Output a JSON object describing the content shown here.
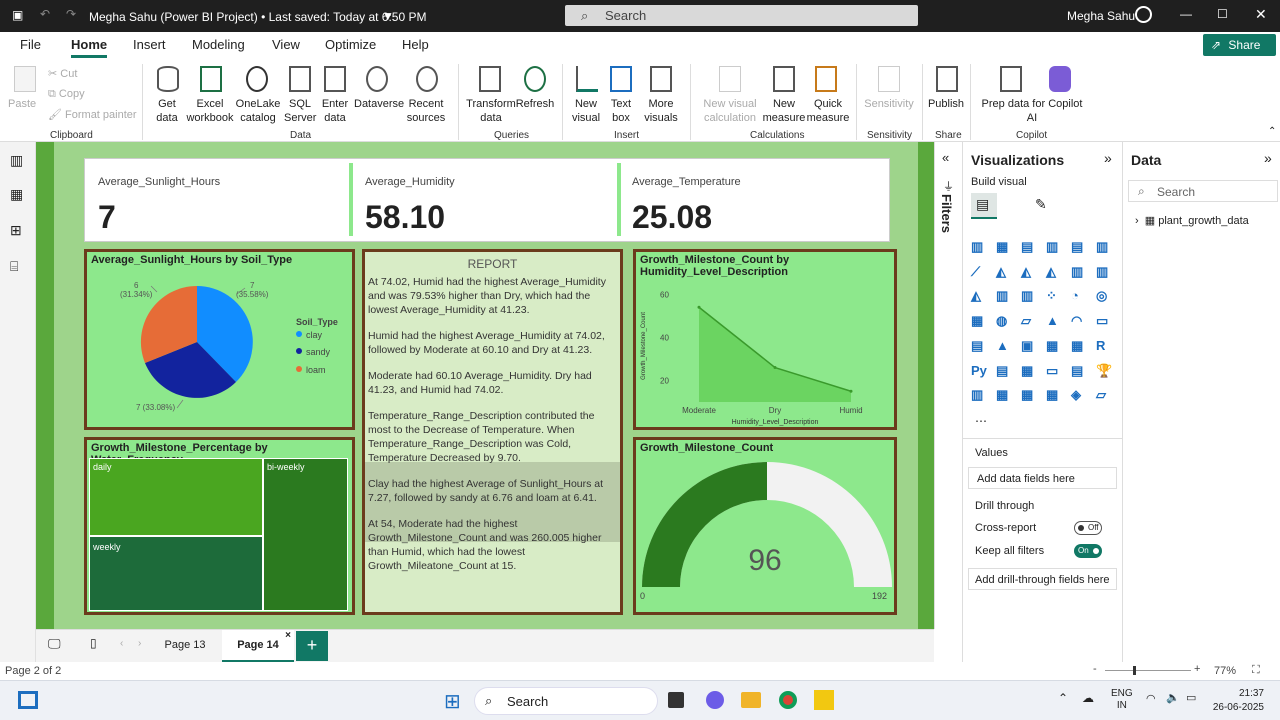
{
  "window": {
    "title": "Megha Sahu (Power BI Project) • Last saved: Today at 6:50 PM",
    "search_placeholder": "Search",
    "user": "Megha Sahu",
    "share": "Share"
  },
  "menu": [
    "File",
    "Home",
    "Insert",
    "Modeling",
    "View",
    "Optimize",
    "Help"
  ],
  "ribbon": {
    "clipboard": {
      "paste": "Paste",
      "cut": "Cut",
      "copy": "Copy",
      "format_painter": "Format painter",
      "group": "Clipboard"
    },
    "data": {
      "get_data": "Get data",
      "excel": "Excel workbook",
      "onelake": "OneLake catalog",
      "sql": "SQL Server",
      "enter": "Enter data",
      "dataverse": "Dataverse",
      "recent": "Recent sources",
      "group": "Data"
    },
    "queries": {
      "transform": "Transform data",
      "refresh": "Refresh",
      "group": "Queries"
    },
    "insert": {
      "new_visual": "New visual",
      "text_box": "Text box",
      "more_visuals": "More visuals",
      "group": "Insert"
    },
    "calculations": {
      "new_visual_calc": "New visual calculation",
      "new_measure": "New measure",
      "quick_measure": "Quick measure",
      "group": "Calculations"
    },
    "sensitivity": {
      "label": "Sensitivity",
      "group": "Sensitivity"
    },
    "share": {
      "publish": "Publish",
      "group": "Share"
    },
    "copilot": {
      "prep": "Prep data for Copilot AI",
      "group": "Copilot"
    }
  },
  "kpis": [
    {
      "label": "Average_Sunlight_Hours",
      "value": "7"
    },
    {
      "label": "Average_Humidity",
      "value": "58.10"
    },
    {
      "label": "Average_Temperature",
      "value": "25.08"
    }
  ],
  "pie": {
    "title": "Average_Sunlight_Hours by Soil_Type",
    "legend_title": "Soil_Type",
    "labels": {
      "clay_val": "7",
      "clay_pct": "(35.58%)",
      "sandy": "7 (33.08%)",
      "loam_val": "6",
      "loam_pct": "(31.34%)"
    },
    "legend": [
      "clay",
      "sandy",
      "loam"
    ],
    "colors": [
      "#118dff",
      "#12239e",
      "#e66c37"
    ]
  },
  "report": {
    "heading": "REPORT",
    "p1": "At 74.02, Humid had the highest Average_Humidity and was 79.53% higher than Dry, which had the lowest Average_Humidity at 41.23.",
    "p2": "Humid had the highest Average_Humidity at 74.02, followed by Moderate at 60.10 and Dry at 41.23.",
    "p3": "Moderate had 60.10 Average_Humidity. Dry had 41.23, and Humid had 74.02.",
    "p4": "Temperature_Range_Description contributed the most to the Decrease of Temperature. When Temperature_Range_Description was Cold, Temperature Decreased by 9.70.",
    "p5": "Clay had the highest Average of Sunlight_Hours at 7.27, followed by sandy at 6.76 and loam at 6.41.",
    "p6": "At 54, Moderate  had the highest Growth_Milestone_Count and was 260.005 higher than Humid, which had the lowest Growth_Mileatone_Count at 15."
  },
  "treemap": {
    "title": "Growth_Milestone_Percentage by Water_Frequency",
    "cells": [
      "daily",
      "bi-weekly",
      "weekly"
    ]
  },
  "gauge": {
    "title": "Growth_Milestone_Count",
    "value": "96",
    "min": "0",
    "max": "192"
  },
  "chart_data": {
    "type": "area",
    "title": "Growth_Milestone_Count by Humidity_Level_Description",
    "categories": [
      "Moderate",
      "Dry",
      "Humid"
    ],
    "values": [
      54,
      26,
      15
    ],
    "xlabel": "Humidity_Level_Description",
    "ylabel": "Growth_Milestone_Count",
    "yticks": [
      "60",
      "40",
      "20"
    ],
    "ylim": [
      10,
      62
    ]
  },
  "filters_label": "Filters",
  "visualizations": {
    "title": "Visualizations",
    "build": "Build visual",
    "values": "Values",
    "add_data": "Add data fields here",
    "drill": "Drill through",
    "cross": "Cross-report",
    "cross_state": "Off",
    "keep": "Keep all filters",
    "keep_state": "On",
    "add_drill": "Add drill-through fields here"
  },
  "data_pane": {
    "title": "Data",
    "search": "Search",
    "table": "plant_growth_data"
  },
  "tabs": [
    "Page 13",
    "Page 14"
  ],
  "status": {
    "page": "Page 2 of 2",
    "zoom": "77%"
  },
  "taskbar": {
    "search": "Search",
    "lang1": "ENG",
    "lang2": "IN",
    "time": "21:37",
    "date": "26-06-2025"
  }
}
